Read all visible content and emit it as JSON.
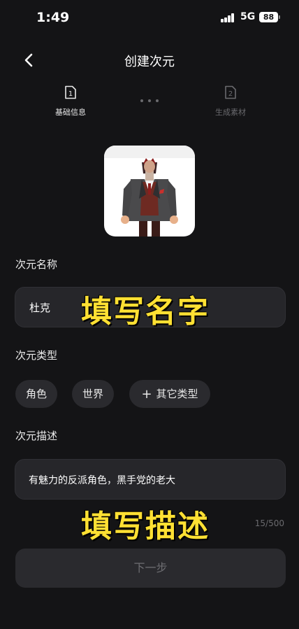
{
  "status_bar": {
    "time": "1:49",
    "network": "5G",
    "battery": "88"
  },
  "nav": {
    "title": "创建次元"
  },
  "steps": [
    {
      "number": "1",
      "label": "基础信息"
    },
    {
      "number": "2",
      "label": "生成素材"
    }
  ],
  "form": {
    "name_label": "次元名称",
    "name_value": "杜克",
    "type_label": "次元类型",
    "types": [
      "角色",
      "世界",
      "其它类型"
    ],
    "desc_label": "次元描述",
    "desc_value": "有魅力的反派角色，黑手党的老大",
    "char_count": "15/500"
  },
  "overlays": {
    "name_hint": "填写名字",
    "desc_hint": "填写描述"
  },
  "next_button": "下一步",
  "colors": {
    "background": "#141416",
    "field": "#26262a",
    "overlay_text": "#ffe033"
  }
}
